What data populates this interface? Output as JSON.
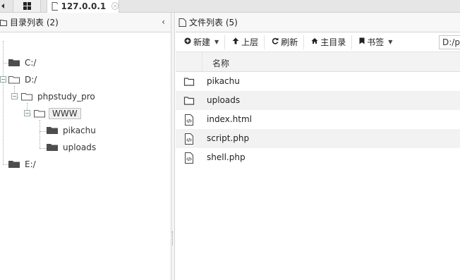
{
  "tabs": {
    "active_label": "127.0.0.1",
    "close_glyph": "×"
  },
  "dir_panel": {
    "title": "目录列表 (2)",
    "collapse_glyph": "‹",
    "tree": [
      {
        "label": "C:/",
        "icon": "folder-filled-icon"
      },
      {
        "label": "D:/",
        "icon": "folder-open-icon"
      },
      {
        "label": "phpstudy_pro",
        "icon": "folder-open-icon"
      },
      {
        "label": "WWW",
        "icon": "folder-open-icon",
        "selected": true
      },
      {
        "label": "pikachu",
        "icon": "folder-filled-icon"
      },
      {
        "label": "uploads",
        "icon": "folder-filled-icon"
      },
      {
        "label": "E:/",
        "icon": "folder-filled-icon"
      }
    ]
  },
  "file_panel": {
    "title": "文件列表 (5)",
    "toolbar": {
      "new_label": "新建",
      "up_label": "上层",
      "refresh_label": "刷新",
      "home_label": "主目录",
      "bookmark_label": "书签",
      "path_value": "D:/p"
    },
    "columns": {
      "name": "名称"
    },
    "files": [
      {
        "name": "pikachu",
        "type": "folder"
      },
      {
        "name": "uploads",
        "type": "folder"
      },
      {
        "name": "index.html",
        "type": "code-file"
      },
      {
        "name": "script.php",
        "type": "code-file"
      },
      {
        "name": "shell.php",
        "type": "code-file"
      }
    ]
  }
}
